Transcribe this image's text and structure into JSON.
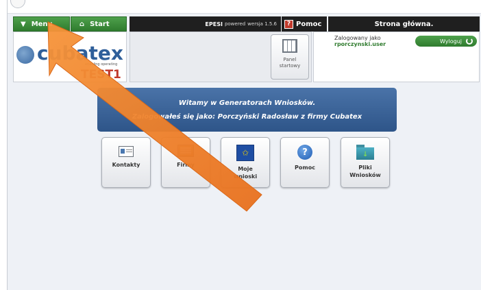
{
  "header": {
    "menu_label": "Menu",
    "start_label": "Start",
    "epesi_brand": "EPESI",
    "epesi_powered": "powered",
    "epesi_version": "wersja 1.5.6",
    "pomoc_label": "Pomoc",
    "page_title": "Strona główna."
  },
  "logo": {
    "brand": "cubatex",
    "tagline": "enabling operating",
    "env": "TEST1"
  },
  "panel": {
    "label_line1": "Panel",
    "label_line2": "startowy"
  },
  "user": {
    "logged_as": "Zalogowany jako",
    "username": "rporczynski.user",
    "logout_label": "Wyloguj"
  },
  "banner": {
    "line1": "Witamy w Generatorach Wniosków.",
    "line2": "Zalogowałeś się jako: Porczyński Radosław z firmy Cubatex"
  },
  "tiles": [
    {
      "label": "Kontakty",
      "icon": "contact-card-icon"
    },
    {
      "label": "Firmy",
      "icon": "company-icon"
    },
    {
      "label": "Moje wnioski",
      "icon": "eu-flag-icon"
    },
    {
      "label": "Pomoc",
      "icon": "help-icon"
    },
    {
      "label": "Pliki Wniosków",
      "icon": "folder-icon"
    }
  ],
  "colors": {
    "green_button": "#2f7b2e",
    "header_dark": "#1f1f1f",
    "banner_blue": "#3a629a",
    "annotation_arrow": "#f07f27",
    "env_red": "#c0392b"
  }
}
